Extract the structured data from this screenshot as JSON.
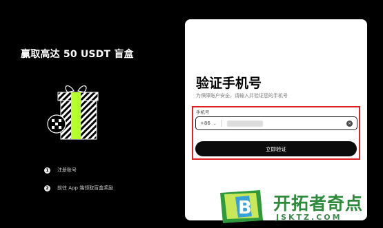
{
  "promo": {
    "title": "赢取高达 50 USDT 盲盒",
    "steps": [
      {
        "num": "1",
        "label": "注册账号"
      },
      {
        "num": "2",
        "label": "前往 App 端领取盲盒奖励"
      }
    ]
  },
  "verify": {
    "title": "验证手机号",
    "subtitle": "为保障账户安全，请输入并验证您的手机号",
    "field_label": "手机号",
    "country_code": "+86",
    "submit_label": "立即验证"
  },
  "watermark": {
    "text": "开拓者奇点",
    "url": "JSKTZ.COM",
    "logo_letter": "B"
  },
  "colors": {
    "highlight": "#e02020",
    "gift_ribbon": "#b5ff2a",
    "watermark_green": "#2c8a3a"
  }
}
